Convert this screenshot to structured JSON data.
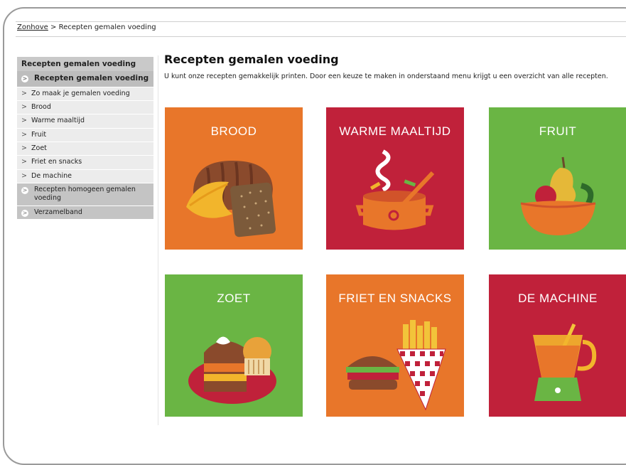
{
  "breadcrumb": {
    "home": "Zonhove",
    "sep": " > ",
    "current": "Recepten gemalen voeding"
  },
  "sidebar": {
    "header": "Recepten gemalen voeding",
    "items": [
      {
        "label": "Recepten gemalen voeding",
        "style": "active"
      },
      {
        "label": "Zo maak je gemalen voeding",
        "style": "sub"
      },
      {
        "label": "Brood",
        "style": "sub"
      },
      {
        "label": "Warme maaltijd",
        "style": "sub"
      },
      {
        "label": "Fruit",
        "style": "sub"
      },
      {
        "label": "Zoet",
        "style": "sub"
      },
      {
        "label": "Friet en snacks",
        "style": "sub"
      },
      {
        "label": "De machine",
        "style": "sub"
      },
      {
        "label": "Recepten homogeen gemalen voeding",
        "style": "group"
      },
      {
        "label": "Verzamelband",
        "style": "group"
      }
    ]
  },
  "main": {
    "title": "Recepten gemalen voeding",
    "intro": "U kunt onze recepten gemakkelijk printen. Door een keuze te maken in onderstaand menu krijgt u een overzicht van alle recepten."
  },
  "tiles": [
    {
      "label": "BROOD",
      "color": "#e8762a"
    },
    {
      "label": "WARME MAALTIJD",
      "color": "#c0213a"
    },
    {
      "label": "FRUIT",
      "color": "#6ab544"
    },
    {
      "label": "ZOET",
      "color": "#6ab544"
    },
    {
      "label": "FRIET EN SNACKS",
      "color": "#e8762a"
    },
    {
      "label": "DE MACHINE",
      "color": "#c0213a"
    }
  ]
}
